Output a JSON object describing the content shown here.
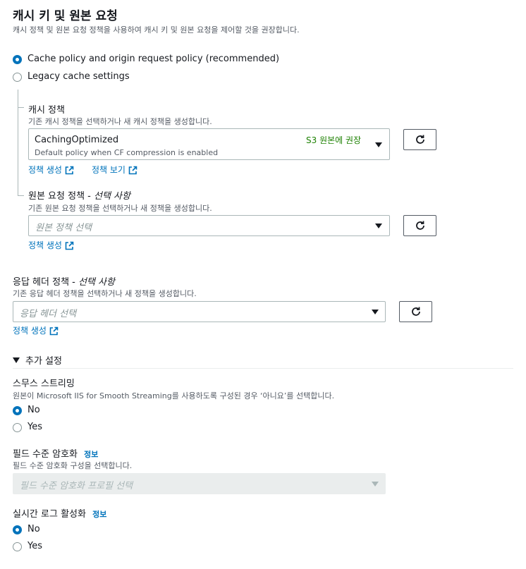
{
  "header": {
    "title": "캐시 키 및 원본 요청",
    "description": "캐시 정책 및 원본 요청 정책을 사용하여 캐시 키 및 원본 요청을 제어할 것을 권장합니다."
  },
  "cache_mode": {
    "options": [
      {
        "label": "Cache policy and origin request policy (recommended)",
        "selected": true
      },
      {
        "label": "Legacy cache settings",
        "selected": false
      }
    ]
  },
  "cache_policy": {
    "label": "캐시 정책",
    "description": "기존 캐시 정책을 선택하거나 새 캐시 정책을 생성합니다.",
    "selected_value": "CachingOptimized",
    "selected_subtext": "Default policy when CF compression is enabled",
    "recommend_badge": "S3 원본에 권장",
    "create_link": "정책 생성",
    "view_link": "정책 보기"
  },
  "origin_request_policy": {
    "label": "원본 요청 정책 - ",
    "label_optional": "선택 사항",
    "description": "기존 원본 요청 정책을 선택하거나 새 정책을 생성합니다.",
    "placeholder": "원본 정책 선택",
    "create_link": "정책 생성"
  },
  "response_headers_policy": {
    "label": "응답 헤더 정책 - ",
    "label_optional": "선택 사항",
    "description": "기존 응답 헤더 정책을 선택하거나 새 정책을 생성합니다.",
    "placeholder": "응답 헤더 선택",
    "create_link": "정책 생성"
  },
  "additional_settings": {
    "label": "추가 설정"
  },
  "smooth_streaming": {
    "label": "스무스 스트리밍",
    "description": "원본이 Microsoft IIS for Smooth Streaming를 사용하도록 구성된 경우 ‘아니요’를 선택합니다.",
    "options": [
      {
        "label": "No",
        "selected": true
      },
      {
        "label": "Yes",
        "selected": false
      }
    ]
  },
  "field_level_encryption": {
    "label": "필드 수준 암호화",
    "info_link": "정보",
    "description": "필드 수준 암호화 구성을 선택합니다.",
    "placeholder": "필드 수준 암호화 프로필 선택"
  },
  "realtime_logs": {
    "label": "실시간 로그 활성화",
    "info_link": "정보",
    "options": [
      {
        "label": "No",
        "selected": true
      },
      {
        "label": "Yes",
        "selected": false
      }
    ]
  },
  "colors": {
    "accent": "#0073bb",
    "badge_green": "#1d8102",
    "border": "#aab7b8"
  }
}
